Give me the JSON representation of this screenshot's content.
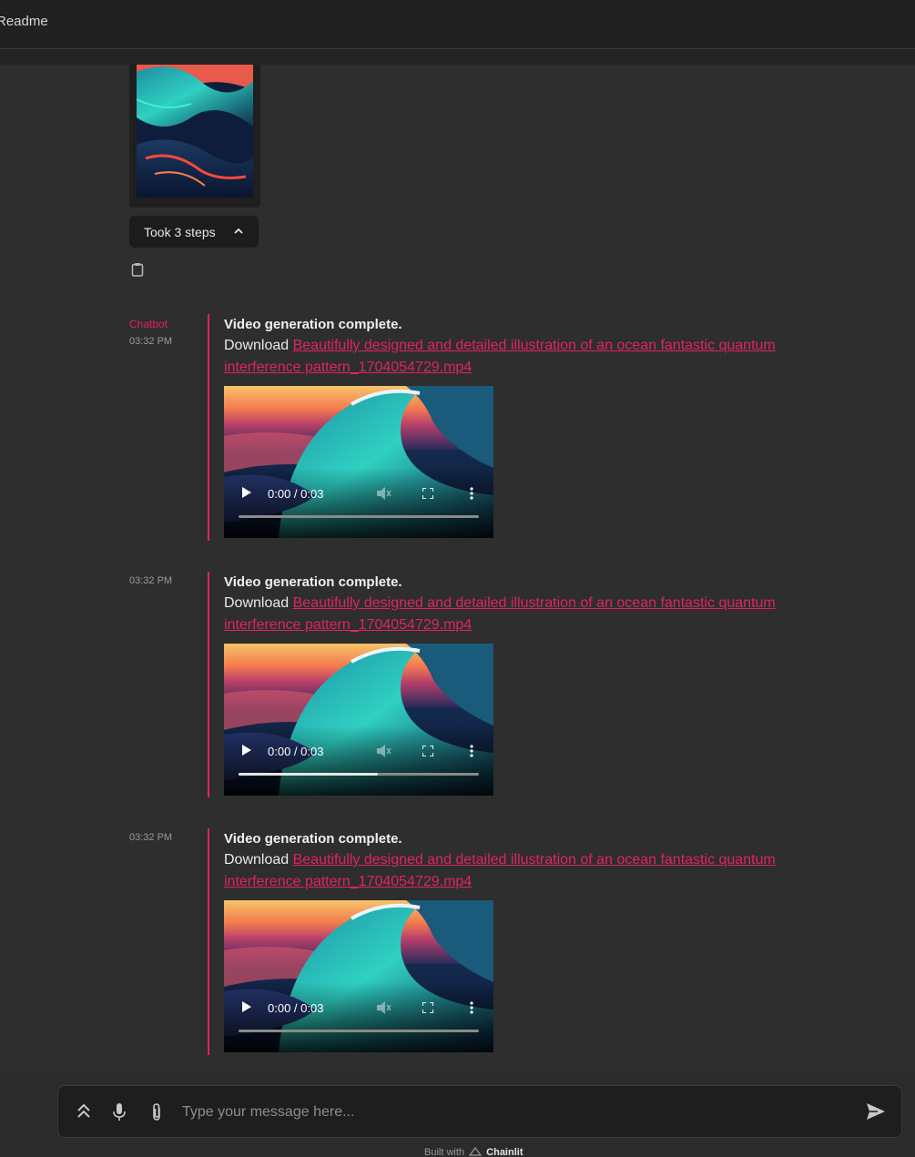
{
  "header": {
    "readme_label": "Readme"
  },
  "prev_step": {
    "steps_label": "Took 3 steps"
  },
  "messages": [
    {
      "author": "Chatbot",
      "time": "03:32 PM",
      "title": "Video generation complete.",
      "download_prefix": "Download",
      "file_link": "Beautifully designed and detailed illustration of an ocean fantastic quantum interference pattern_1704054729.mp4",
      "video_time": "0:00 / 0:03",
      "progress": 0
    },
    {
      "author": "",
      "time": "03:32 PM",
      "title": "Video generation complete.",
      "download_prefix": "Download",
      "file_link": "Beautifully designed and detailed illustration of an ocean fantastic quantum interference pattern_1704054729.mp4",
      "video_time": "0:00 / 0:03",
      "progress": 0.58
    },
    {
      "author": "",
      "time": "03:32 PM",
      "title": "Video generation complete.",
      "download_prefix": "Download",
      "file_link": "Beautifully designed and detailed illustration of an ocean fantastic quantum interference pattern_1704054729.mp4",
      "video_time": "0:00 / 0:03",
      "progress": 0
    }
  ],
  "composer": {
    "placeholder": "Type your message here..."
  },
  "footer": {
    "built_with": "Built with",
    "brand": "Chainlit"
  },
  "colors": {
    "accent": "#e0245e",
    "background": "#2e2e2e",
    "topbar": "#212121"
  },
  "icons": [
    "clipboard-icon",
    "chevron-up-icon",
    "play-icon",
    "mute-icon",
    "fullscreen-icon",
    "more-vertical-icon",
    "double-chevron-up-icon",
    "microphone-icon",
    "paperclip-icon",
    "send-icon"
  ]
}
